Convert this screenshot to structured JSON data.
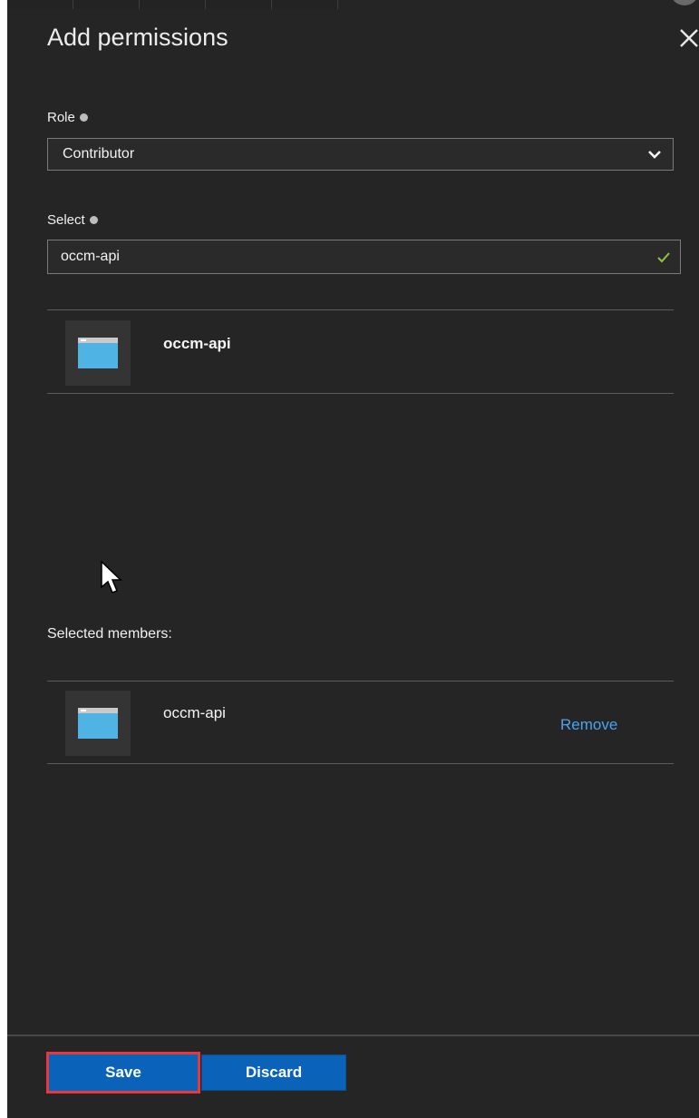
{
  "panel": {
    "title": "Add permissions"
  },
  "role": {
    "label": "Role",
    "selected_value": "Contributor"
  },
  "select": {
    "label": "Select",
    "value": "occm-api"
  },
  "search_results": [
    {
      "name": "occm-api"
    }
  ],
  "selected_members": {
    "title": "Selected members:",
    "items": [
      {
        "name": "occm-api",
        "action_label": "Remove"
      }
    ]
  },
  "footer": {
    "save_label": "Save",
    "discard_label": "Discard"
  },
  "colors": {
    "panel_background": "#252525",
    "primary_button": "#0a63b8",
    "highlight_outline": "#e8383d",
    "link": "#4aa3f0",
    "valid_check": "#8cc63f",
    "app_icon": "#4fb3e3"
  }
}
